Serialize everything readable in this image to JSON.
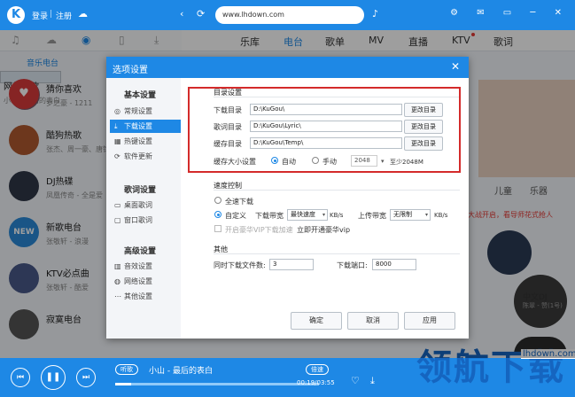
{
  "topbar": {
    "login": "登录",
    "separator": "|",
    "register": "注册",
    "address": "www.lhdown.com"
  },
  "left_panel": {
    "section_title": "音乐电台"
  },
  "nav": {
    "items": [
      "乐库",
      "电台",
      "歌单",
      "MV",
      "直播",
      "KTV",
      "歌词"
    ],
    "active": "电台"
  },
  "stations": [
    {
      "name": "网络红歌",
      "sub": "小山 - 最后的表白",
      "color": "#7a5a6a"
    },
    {
      "name": "猜你喜欢",
      "sub": "罗之豪 - 1211",
      "color": "#d93a3a"
    },
    {
      "name": "酷狗热歌",
      "sub": "张杰、周一豪、唐钧",
      "color": "#b05a30"
    },
    {
      "name": "DJ热碟",
      "sub": "凤凰传奇 - 全是爱",
      "color": "#303848"
    },
    {
      "name": "新歌电台",
      "sub": "张敬轩 - 浪漫",
      "color": "#2a8ad8",
      "badge": "NEW"
    },
    {
      "name": "KTV必点曲",
      "sub": "张敬轩 - 酷爱",
      "color": "#4a5a8a"
    },
    {
      "name": "寂寞电台",
      "sub": "",
      "color": "#555555"
    }
  ],
  "right_content": {
    "tabs": [
      "儿童",
      "乐器"
    ],
    "promo": "人大战开启，看导师花式抢人",
    "card_label": "中文DJ",
    "card_sub": "陈翠 - 赞(1号)"
  },
  "dialog": {
    "title": "选项设置",
    "sidebar": {
      "groups": [
        {
          "title": "基本设置",
          "items": [
            "常规设置",
            "下载设置",
            "热键设置",
            "软件更新"
          ]
        },
        {
          "title": "歌词设置",
          "items": [
            "桌面歌词",
            "窗口歌词"
          ]
        },
        {
          "title": "高级设置",
          "items": [
            "音效设置",
            "网络设置",
            "其他设置"
          ]
        }
      ],
      "active": "下载设置"
    },
    "dir_section": {
      "title": "目录设置",
      "rows": [
        {
          "label": "下载目录",
          "value": "D:\\KuGou\\",
          "button": "更改目录"
        },
        {
          "label": "歌词目录",
          "value": "D:\\KuGou\\Lyric\\",
          "button": "更改目录"
        },
        {
          "label": "缓存目录",
          "value": "D:\\KuGou\\Temp\\",
          "button": "更改目录"
        }
      ],
      "cache_label": "缓存大小设置",
      "auto": "自动",
      "manual": "手动",
      "cache_value": "2048",
      "cache_hint": "至少2048M"
    },
    "speed_section": {
      "title": "速度控制",
      "full_speed": "全速下载",
      "custom": "自定义",
      "down_label": "下载带宽",
      "down_value": "最快速度",
      "down_unit": "KB/s",
      "up_label": "上传带宽",
      "up_value": "无限制",
      "up_unit": "KB/s",
      "vip_accel": "开启豪华VIP下载加速",
      "vip_link": "立即开通豪华vip"
    },
    "other_section": {
      "title": "其他",
      "concurrent_label": "同时下载文件数:",
      "concurrent_value": "3",
      "port_label": "下载端口:",
      "port_value": "8000"
    },
    "buttons": {
      "ok": "确定",
      "cancel": "取消",
      "apply": "应用"
    }
  },
  "player": {
    "tag_listen": "听歌",
    "song": "小山 - 最后的表白",
    "tag_speed": "倍速",
    "time": "00:19/03:55",
    "progress": 0.08
  },
  "watermark": {
    "text": "领航下载",
    "url": "lhdown.com"
  },
  "colors": {
    "primary": "#1e88e5",
    "highlight_box": "#d42b2b"
  }
}
